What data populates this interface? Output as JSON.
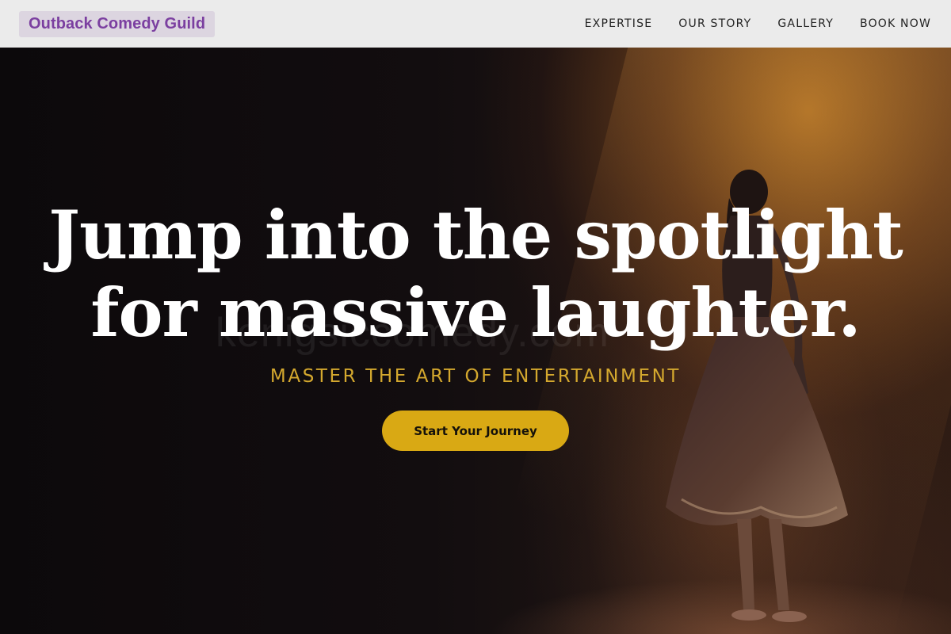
{
  "brand": {
    "name": "Outback Comedy Guild"
  },
  "nav": {
    "items": [
      {
        "label": "EXPERTISE"
      },
      {
        "label": "OUR STORY"
      },
      {
        "label": "GALLERY"
      },
      {
        "label": "BOOK NOW"
      }
    ]
  },
  "hero": {
    "headline_line1": "Jump into the spotlight",
    "headline_line2": "for massive laughter.",
    "tagline": "MASTER THE ART OF ENTERTAINMENT",
    "cta_label": "Start Your Journey"
  },
  "colors": {
    "brand_text": "#7b3fa0",
    "accent_gold": "#d9a914",
    "tagline_gold": "#d4a82e",
    "navbar_bg": "#ebebeb"
  }
}
